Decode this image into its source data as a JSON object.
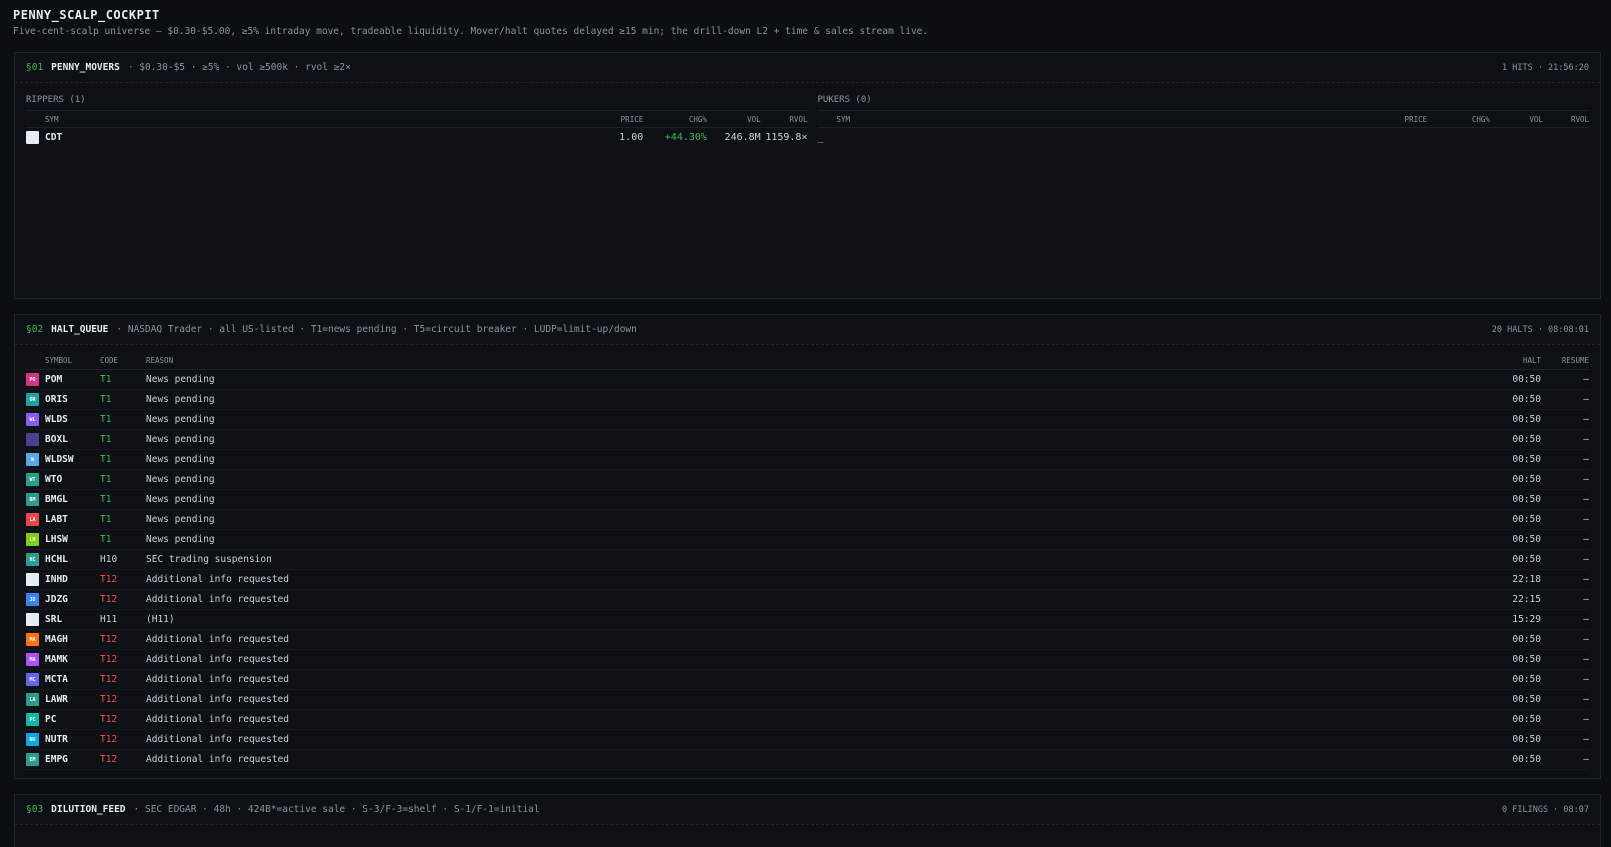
{
  "app": {
    "title": "PENNY_SCALP_COCKPIT",
    "subtitle": "Five-cent-scalp universe — $0.30-$5.00, ≥5% intraday move, tradeable liquidity. Mover/halt quotes delayed ≥15 min; the drill-down L2 + time & sales stream live."
  },
  "movers": {
    "num": "§01",
    "name": "PENNY_MOVERS",
    "desc": "· $0.30-$5 · ≥5% · vol ≥500k · rvol ≥2×",
    "meta": "1 HITS · 21:56:20",
    "rippers_title": "RIPPERS (1)",
    "pukers_title": "PUKERS (0)",
    "headers": {
      "sym": "SYM",
      "price": "PRICE",
      "chg": "CHG%",
      "vol": "VOL",
      "rvol": "RVOL"
    },
    "rippers": [
      {
        "sym": "CDT",
        "price": "1.00",
        "chg": "+44.30%",
        "vol": "246.8M",
        "rvol": "1159.8×",
        "logo_color": "#e6edf3",
        "logo_text": ""
      }
    ],
    "pukers_empty": "_"
  },
  "halts": {
    "num": "§02",
    "name": "HALT_QUEUE",
    "desc": "· NASDAQ Trader · all US-listed · T1=news pending · T5=circuit breaker · LUDP=limit-up/down",
    "meta": "20 HALTS · 08:08:01",
    "headers": {
      "symbol": "SYMBOL",
      "code": "CODE",
      "reason": "REASON",
      "halt": "HALT",
      "resume": "RESUME"
    },
    "rows": [
      {
        "sym": "POM",
        "code": "T1",
        "reason": "News pending",
        "halt": "00:50",
        "resume": "—",
        "logo_color": "#d63384",
        "logo_text": "PO",
        "code_class": "code-t1"
      },
      {
        "sym": "ORIS",
        "code": "T1",
        "reason": "News pending",
        "halt": "00:50",
        "resume": "—",
        "logo_color": "#20a39e",
        "logo_text": "OR",
        "code_class": "code-t1"
      },
      {
        "sym": "WLDS",
        "code": "T1",
        "reason": "News pending",
        "halt": "00:50",
        "resume": "—",
        "logo_color": "#8b5cf6",
        "logo_text": "WL",
        "code_class": "code-t1"
      },
      {
        "sym": "BOXL",
        "code": "T1",
        "reason": "News pending",
        "halt": "00:50",
        "resume": "—",
        "logo_color": "#4b3f8f",
        "logo_text": "",
        "code_class": "code-t1"
      },
      {
        "sym": "WLDSW",
        "code": "T1",
        "reason": "News pending",
        "halt": "00:50",
        "resume": "—",
        "logo_color": "#5aa9e6",
        "logo_text": "W",
        "code_class": "code-t1"
      },
      {
        "sym": "WTO",
        "code": "T1",
        "reason": "News pending",
        "halt": "00:50",
        "resume": "—",
        "logo_color": "#2a9d8f",
        "logo_text": "WT",
        "code_class": "code-t1"
      },
      {
        "sym": "BMGL",
        "code": "T1",
        "reason": "News pending",
        "halt": "00:50",
        "resume": "—",
        "logo_color": "#2a9d8f",
        "logo_text": "BM",
        "code_class": "code-t1"
      },
      {
        "sym": "LABT",
        "code": "T1",
        "reason": "News pending",
        "halt": "00:50",
        "resume": "—",
        "logo_color": "#e5484d",
        "logo_text": "LA",
        "code_class": "code-t1"
      },
      {
        "sym": "LHSW",
        "code": "T1",
        "reason": "News pending",
        "halt": "00:50",
        "resume": "—",
        "logo_color": "#84cc16",
        "logo_text": "LH",
        "code_class": "code-t1"
      },
      {
        "sym": "HCHL",
        "code": "H10",
        "reason": "SEC trading suspension",
        "halt": "00:50",
        "resume": "—",
        "logo_color": "#2a9d8f",
        "logo_text": "HC",
        "code_class": "code-h"
      },
      {
        "sym": "INHD",
        "code": "T12",
        "reason": "Additional info requested",
        "halt": "22:18",
        "resume": "—",
        "logo_color": "#e6edf3",
        "logo_text": "",
        "code_class": "code-t12"
      },
      {
        "sym": "JDZG",
        "code": "T12",
        "reason": "Additional info requested",
        "halt": "22:15",
        "resume": "—",
        "logo_color": "#3b82f6",
        "logo_text": "JD",
        "code_class": "code-t12"
      },
      {
        "sym": "SRL",
        "code": "H11",
        "reason": "(H11)",
        "halt": "15:29",
        "resume": "—",
        "logo_color": "#e6edf3",
        "logo_text": "",
        "code_class": "code-h"
      },
      {
        "sym": "MAGH",
        "code": "T12",
        "reason": "Additional info requested",
        "halt": "00:50",
        "resume": "—",
        "logo_color": "#f97316",
        "logo_text": "MA",
        "code_class": "code-t12"
      },
      {
        "sym": "MAMK",
        "code": "T12",
        "reason": "Additional info requested",
        "halt": "00:50",
        "resume": "—",
        "logo_color": "#a855f7",
        "logo_text": "MA",
        "code_class": "code-t12"
      },
      {
        "sym": "MCTA",
        "code": "T12",
        "reason": "Additional info requested",
        "halt": "00:50",
        "resume": "—",
        "logo_color": "#6366f1",
        "logo_text": "MC",
        "code_class": "code-t12"
      },
      {
        "sym": "LAWR",
        "code": "T12",
        "reason": "Additional info requested",
        "halt": "00:50",
        "resume": "—",
        "logo_color": "#2a9d8f",
        "logo_text": "LA",
        "code_class": "code-t12"
      },
      {
        "sym": "PC",
        "code": "T12",
        "reason": "Additional info requested",
        "halt": "00:50",
        "resume": "—",
        "logo_color": "#14b8a6",
        "logo_text": "PC",
        "code_class": "code-t12"
      },
      {
        "sym": "NUTR",
        "code": "T12",
        "reason": "Additional info requested",
        "halt": "00:50",
        "resume": "—",
        "logo_color": "#0ea5e9",
        "logo_text": "NU",
        "code_class": "code-t12"
      },
      {
        "sym": "EMPG",
        "code": "T12",
        "reason": "Additional info requested",
        "halt": "00:50",
        "resume": "—",
        "logo_color": "#2a9d8f",
        "logo_text": "EM",
        "code_class": "code-t12"
      }
    ]
  },
  "dilution": {
    "num": "§03",
    "name": "DILUTION_FEED",
    "desc": "· SEC EDGAR · 48h · 424B*=active sale · S-3/F-3=shelf · S-1/F-1=initial",
    "meta": "0 FILINGS · 08:07"
  }
}
